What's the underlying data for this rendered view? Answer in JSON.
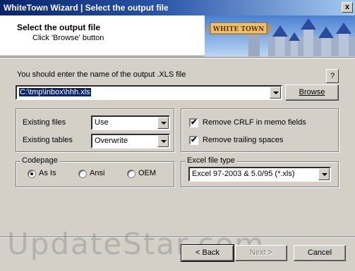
{
  "window": {
    "title": "WhiteTown Wizard | Select the output file",
    "close_label": "x"
  },
  "header": {
    "title": "Select the output file",
    "subtitle": "Click 'Browse' button",
    "banner_text": "WHITE TOWN"
  },
  "main": {
    "instruction": "You should enter the name of the output .XLS file",
    "help_label": "?",
    "file_path": "C:\\tmp\\inbox\\hhh.xls",
    "browse_label": "Browse"
  },
  "options": {
    "existing_files_label": "Existing files",
    "existing_files_value": "Use",
    "existing_tables_label": "Existing tables",
    "existing_tables_value": "Overwrite",
    "remove_crlf_label": "Remove CRLF in memo fields",
    "remove_crlf_checked": true,
    "remove_trailing_label": "Remove trailing spaces",
    "remove_trailing_checked": true
  },
  "codepage": {
    "title": "Codepage",
    "options": [
      "As Is",
      "Ansi",
      "OEM"
    ],
    "selected": "As Is"
  },
  "excel_type": {
    "title": "Excel file type",
    "value": "Excel 97-2003 & 5.0/95 (*.xls)"
  },
  "buttons": {
    "back": "< Back",
    "next": "Next >",
    "cancel": "Cancel"
  },
  "watermark": "UpdateStar.com",
  "colors": {
    "titlebar_start": "#0a246a",
    "titlebar_end": "#a6caf0",
    "face": "#d4d0c8"
  }
}
